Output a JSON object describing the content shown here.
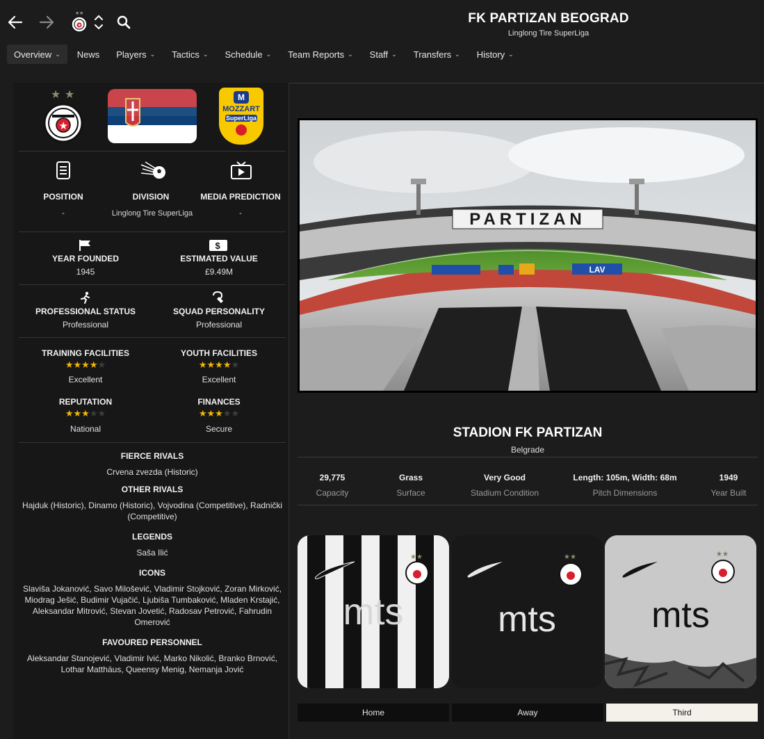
{
  "header": {
    "club_name": "FK PARTIZAN BEOGRAD",
    "league": "Linglong Tire SuperLiga"
  },
  "menu": [
    {
      "label": "Overview",
      "dropdown": true
    },
    {
      "label": "News",
      "dropdown": false
    },
    {
      "label": "Players",
      "dropdown": true
    },
    {
      "label": "Tactics",
      "dropdown": true
    },
    {
      "label": "Schedule",
      "dropdown": true
    },
    {
      "label": "Team Reports",
      "dropdown": true
    },
    {
      "label": "Staff",
      "dropdown": true
    },
    {
      "label": "Transfers",
      "dropdown": true
    },
    {
      "label": "History",
      "dropdown": true
    }
  ],
  "badges": {
    "league_logo_top": "MOZZART",
    "league_logo_bottom": "SuperLiga"
  },
  "overview": {
    "position": {
      "label": "POSITION",
      "value": "-"
    },
    "division": {
      "label": "DIVISION",
      "value": "Linglong Tire SuperLiga"
    },
    "media_prediction": {
      "label": "MEDIA PREDICTION",
      "value": "-"
    },
    "year_founded": {
      "label": "YEAR FOUNDED",
      "value": "1945"
    },
    "estimated_value": {
      "label": "ESTIMATED VALUE",
      "value": "£9.49M"
    },
    "professional_status": {
      "label": "PROFESSIONAL STATUS",
      "value": "Professional"
    },
    "squad_personality": {
      "label": "SQUAD PERSONALITY",
      "value": "Professional"
    },
    "training_facilities": {
      "label": "TRAINING FACILITIES",
      "value": "Excellent",
      "stars": 4
    },
    "youth_facilities": {
      "label": "YOUTH FACILITIES",
      "value": "Excellent",
      "stars": 4
    },
    "reputation": {
      "label": "REPUTATION",
      "value": "National",
      "stars": 3
    },
    "finances": {
      "label": "FINANCES",
      "value": "Secure",
      "stars": 3
    },
    "fierce_rivals": {
      "label": "FIERCE RIVALS",
      "value": "Crvena zvezda (Historic)"
    },
    "other_rivals": {
      "label": "OTHER RIVALS",
      "value": "Hajduk (Historic), Dinamo (Historic), Vojvodina (Competitive), Radnički (Competitive)"
    },
    "legends": {
      "label": "LEGENDS",
      "value": "Saša Ilić"
    },
    "icons": {
      "label": "ICONS",
      "value": "Slaviša Jokanović, Savo Milošević, Vladimir Stojković, Zoran Mirković, Miodrag Ješić, Budimir Vujačić, Ljubiša Tumbaković, Mladen Krstajić, Aleksandar Mitrović, Stevan Jovetić, Radosav Petrović, Fahrudin Omerović"
    },
    "favoured_personnel": {
      "label": "FAVOURED PERSONNEL",
      "value": "Aleksandar Stanojević, Vladimir Ivić, Marko Nikolić, Branko Brnović, Lothar Matthäus, Queensy Menig, Nemanja Jović"
    }
  },
  "stadium": {
    "name": "STADION FK PARTIZAN",
    "city": "Belgrade",
    "banner_text": "PARTIZAN",
    "ad_text": "LAV",
    "stats": [
      {
        "value": "29,775",
        "label": "Capacity"
      },
      {
        "value": "Grass",
        "label": "Surface"
      },
      {
        "value": "Very Good",
        "label": "Stadium Condition"
      },
      {
        "value": "Length: 105m, Width: 68m",
        "label": "Pitch Dimensions"
      },
      {
        "value": "1949",
        "label": "Year Built"
      }
    ]
  },
  "kits": {
    "sponsor": "mts",
    "tabs": [
      {
        "label": "Home",
        "selected": false
      },
      {
        "label": "Away",
        "selected": false
      },
      {
        "label": "Third",
        "selected": true
      }
    ]
  },
  "colors": {
    "star_on": "#f2b705",
    "star_off": "#3d3d3d",
    "selected_tab": "#f3f1ea"
  }
}
